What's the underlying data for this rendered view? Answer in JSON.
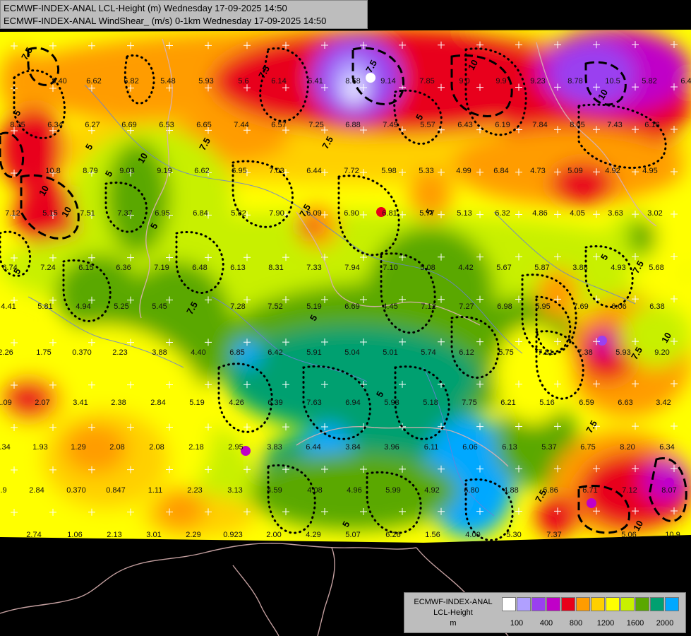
{
  "header": {
    "line1": "ECMWF-INDEX-ANAL LCL-Height (m) Wednesday 17-09-2025 14:50",
    "line2": "ECMWF-INDEX-ANAL WindShear_ (m/s) 0-1km Wednesday 17-09-2025 14:50"
  },
  "legend": {
    "title_lines": [
      "ECMWF-INDEX-ANAL",
      "LCL-Height",
      "m"
    ],
    "colors": [
      "#ffffff",
      "#b0a0ff",
      "#9a40f0",
      "#c000c8",
      "#e8001a",
      "#ff9c00",
      "#ffd000",
      "#ffff00",
      "#c8f000",
      "#5aa800",
      "#00a070",
      "#00a8ff"
    ],
    "tick_labels": [
      "100",
      "400",
      "800",
      "1200",
      "1600",
      "2000"
    ]
  },
  "map": {
    "field_colors": {
      "white": "#ffffff",
      "lavender": "#b0a0ff",
      "violet": "#9a40f0",
      "magenta": "#c000c8",
      "red": "#e8001a",
      "orange": "#ff9c00",
      "gold": "#ffd000",
      "yellow": "#ffff00",
      "lime": "#c8f000",
      "green": "#5aa800",
      "teal": "#00a070",
      "sky": "#00a8ff"
    },
    "shear_values": [
      "8.40",
      "6.62",
      "6.82",
      "5.48",
      "5.93",
      "5.6",
      "6.14",
      "6.41",
      "8.68",
      "9.14",
      "7.85",
      "9.0",
      "9.9",
      "9.23",
      "8.78",
      "10.5",
      "5.82",
      "6.4",
      "8.35",
      "6.34",
      "6.27",
      "6.69",
      "6.53",
      "6.65",
      "7.44",
      "6.57",
      "7.25",
      "6.88",
      "7.49",
      "5.57",
      "6.43",
      "6.19",
      "7.84",
      "8.05",
      "7.43",
      "6.16",
      "10.8",
      "8.79",
      "9.03",
      "9.19",
      "6.62",
      "6.95",
      "7.03",
      "6.44",
      "7.72",
      "5.98",
      "5.33",
      "4.99",
      "6.84",
      "4.73",
      "5.09",
      "4.92",
      "4.95",
      "7.12",
      "5.15",
      "7.51",
      "7.37",
      "6.95",
      "6.84",
      "5.82",
      "7.90",
      "6.09",
      "6.90",
      "6.81",
      "5.77",
      "5.13",
      "6.32",
      "4.86",
      "4.05",
      "3.63",
      "3.02",
      "6.74",
      "7.24",
      "6.15",
      "6.36",
      "7.19",
      "6.48",
      "6.13",
      "8.31",
      "7.33",
      "7.94",
      "7.10",
      "5.08",
      "4.42",
      "5.67",
      "5.87",
      "3.88",
      "4.93",
      "5.68",
      "4.41",
      "5.81",
      "4.94",
      "5.25",
      "5.45",
      "7.28",
      "7.52",
      "5.19",
      "6.69",
      "4.45",
      "7.12",
      "7.27",
      "6.98",
      "5.95",
      "7.69",
      "6.06",
      "6.38",
      "2.26",
      "1.75",
      "0.370",
      "2.23",
      "3.88",
      "4.40",
      "6.85",
      "6.42",
      "5.91",
      "5.04",
      "5.01",
      "5.74",
      "6.12",
      "5.75",
      "7.81",
      "7.38",
      "5.93",
      "9.20",
      "1.09",
      "2.07",
      "3.41",
      "2.38",
      "2.84",
      "5.19",
      "4.26",
      "6.39",
      "7.63",
      "6.94",
      "5.93",
      "5.18",
      "7.75",
      "6.21",
      "5.16",
      "6.59",
      "6.63",
      "3.42",
      "0.34",
      "1.93",
      "1.29",
      "2.08",
      "2.08",
      "2.18",
      "2.95",
      "3.83",
      "6.44",
      "3.84",
      "3.96",
      "6.11",
      "6.06",
      "6.13",
      "5.37",
      "6.75",
      "8.20",
      "6.34",
      "2.9",
      "2.84",
      "0.370",
      "0.847",
      "1.11",
      "2.23",
      "3.13",
      "4.59",
      "4.08",
      "4.96",
      "5.99",
      "4.92",
      "6.80",
      "4.88",
      "6.86",
      "6.71",
      "7.12",
      "8.07",
      "2.74",
      "1.06",
      "2.13",
      "3.01",
      "2.29",
      "0.923",
      "2.00",
      "4.29",
      "5.07",
      "6.26",
      "1.56",
      "4.00",
      "5.30",
      "7.37",
      "5.06",
      "10.9"
    ],
    "contour_labels": [
      "7.5",
      "5",
      "10",
      "7.5",
      "10",
      "5",
      "7.5",
      "5",
      "7.5",
      "10",
      "5",
      "7.5",
      "5",
      "7.5",
      "5",
      "7.5",
      "10",
      "7.5",
      "5",
      "10",
      "7.5",
      "5",
      "5",
      "7.5",
      "10",
      "5",
      "7.5",
      "10",
      "5"
    ]
  }
}
